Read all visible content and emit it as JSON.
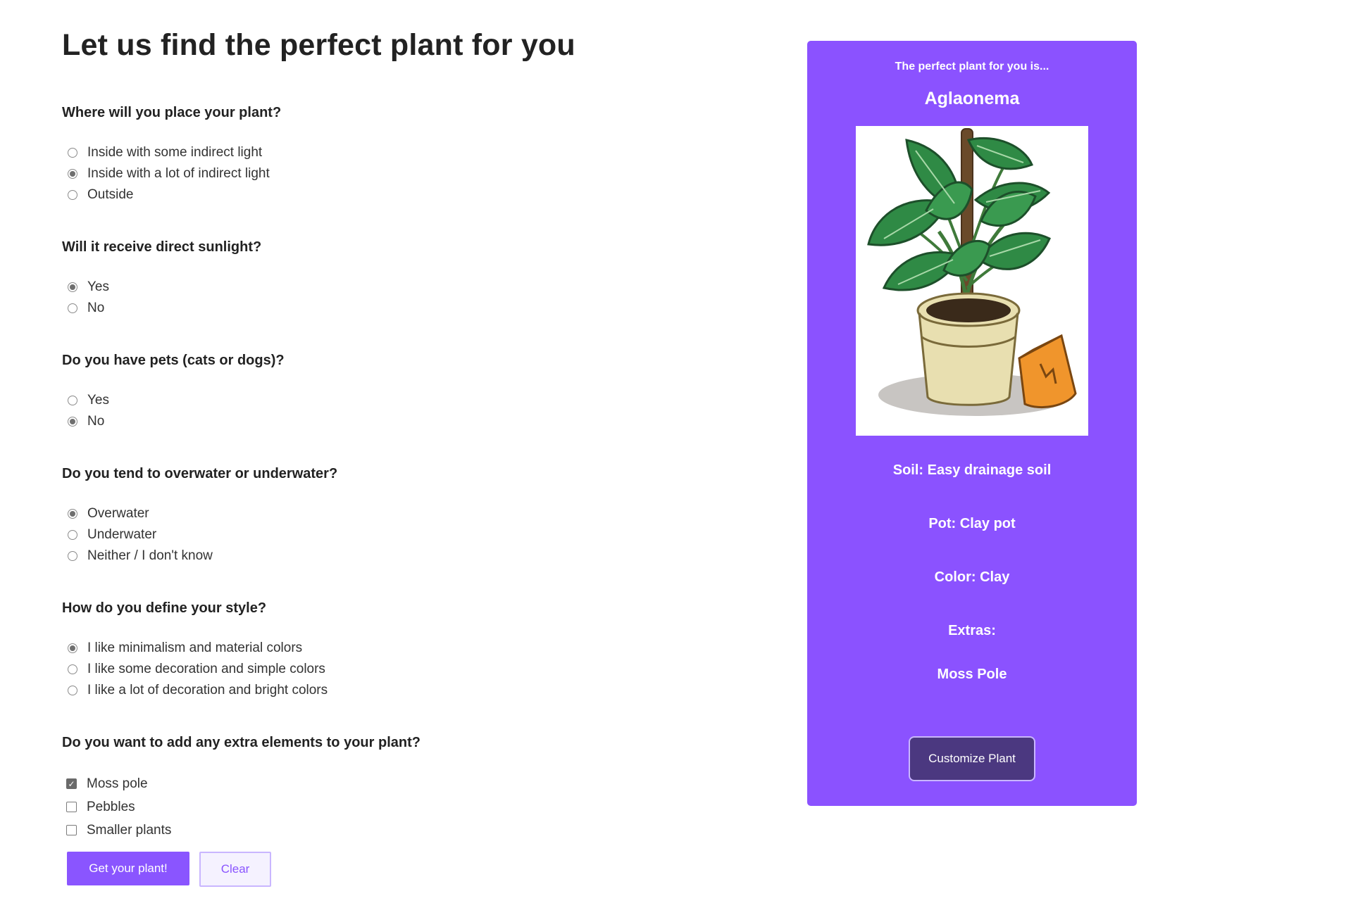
{
  "page_title": "Let us find the perfect plant for you",
  "questions": [
    {
      "label": "Where will you place your plant?",
      "type": "radio",
      "options": [
        {
          "label": "Inside with some indirect light",
          "checked": false
        },
        {
          "label": "Inside with a lot of indirect light",
          "checked": true
        },
        {
          "label": "Outside",
          "checked": false
        }
      ]
    },
    {
      "label": "Will it receive direct sunlight?",
      "type": "radio",
      "options": [
        {
          "label": "Yes",
          "checked": true
        },
        {
          "label": "No",
          "checked": false
        }
      ]
    },
    {
      "label": "Do you have pets (cats or dogs)?",
      "type": "radio",
      "options": [
        {
          "label": "Yes",
          "checked": false
        },
        {
          "label": "No",
          "checked": true
        }
      ]
    },
    {
      "label": "Do you tend to overwater or underwater?",
      "type": "radio",
      "options": [
        {
          "label": "Overwater",
          "checked": true
        },
        {
          "label": "Underwater",
          "checked": false
        },
        {
          "label": "Neither / I don't know",
          "checked": false
        }
      ]
    },
    {
      "label": "How do you define your style?",
      "type": "radio",
      "options": [
        {
          "label": "I like minimalism and material colors",
          "checked": true
        },
        {
          "label": "I like some decoration and simple colors",
          "checked": false
        },
        {
          "label": "I like a lot of decoration and bright colors",
          "checked": false
        }
      ]
    },
    {
      "label": "Do you want to add any extra elements to your plant?",
      "type": "checkbox",
      "options": [
        {
          "label": "Moss pole",
          "checked": true
        },
        {
          "label": "Pebbles",
          "checked": false
        },
        {
          "label": "Smaller plants",
          "checked": false
        }
      ]
    }
  ],
  "buttons": {
    "submit_label": "Get your plant!",
    "clear_label": "Clear"
  },
  "result": {
    "eyebrow": "The perfect plant for you is...",
    "plant_name": "Aglaonema",
    "soil": "Soil: Easy drainage soil",
    "pot": "Pot: Clay pot",
    "color": "Color: Clay",
    "extras_label": "Extras:",
    "extras_item": "Moss Pole",
    "customize_label": "Customize Plant",
    "image_icon": "potted-plant-illustration"
  },
  "colors": {
    "accent": "#8b52ff",
    "customize_button": "#4b3880",
    "leaf": "#2f8a45",
    "pot": "#e8dfb0",
    "bag": "#f0952c"
  }
}
